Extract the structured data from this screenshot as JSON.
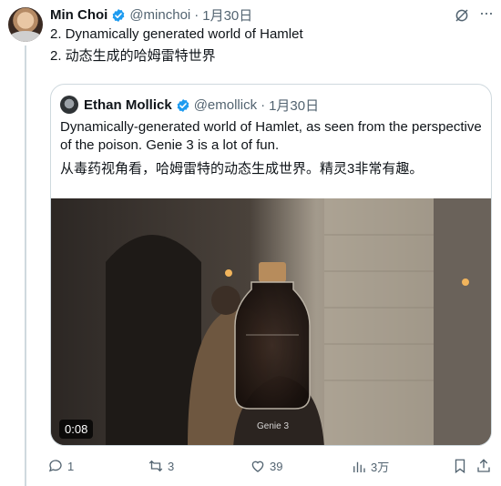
{
  "tweet": {
    "author_name": "Min Choi",
    "author_handle": "@minchoi",
    "date": "1月30日",
    "text_en": "2. Dynamically generated world of Hamlet",
    "text_zh": "2. 动态生成的哈姆雷特世界"
  },
  "quote": {
    "author_name": "Ethan Mollick",
    "author_handle": "@emollick",
    "date": "1月30日",
    "text_line1": "Dynamically-generated world of Hamlet, as seen from the perspective",
    "text_line2": "of the poison. Genie 3 is a lot of fun.",
    "text_zh": "从毒药视角看，哈姆雷特的动态生成世界。精灵3非常有趣。",
    "video_duration": "0:08",
    "video_watermark": "Genie 3"
  },
  "actions": {
    "replies": "1",
    "reposts": "3",
    "likes": "39",
    "views": "3万"
  },
  "colors": {
    "verified": "#1d9bf0",
    "muted": "#536471",
    "border": "#cfd9de"
  }
}
